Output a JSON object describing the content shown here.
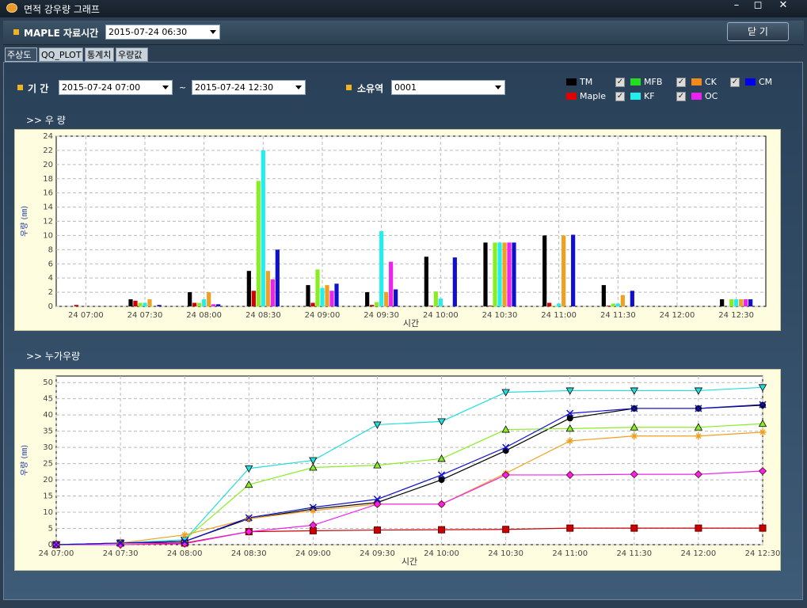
{
  "window": {
    "title": "면적 강우량 그래프",
    "controls": [
      "–",
      "◻",
      "✕"
    ]
  },
  "toolbar": {
    "maple_label": "MAPLE 자료시간",
    "maple_time": "2015-07-24 06:30",
    "close_label": "닫 기"
  },
  "tabs": [
    "주상도",
    "QQ_PLOT",
    "통계치",
    "우량값"
  ],
  "filters": {
    "period_label": "기 간",
    "start": "2015-07-24 07:00",
    "tilde": "~",
    "end": "2015-07-24 12:30",
    "basin_label": "소유역",
    "basin": "0001"
  },
  "legend": [
    {
      "name": "TM",
      "color": "#000000",
      "checkbox": false
    },
    {
      "name": "Maple",
      "color": "#e00000",
      "checkbox": false
    },
    {
      "name": "MFB",
      "color": "#22dd22",
      "checkbox": true
    },
    {
      "name": "KF",
      "color": "#22eeee",
      "checkbox": true
    },
    {
      "name": "CK",
      "color": "#f28a1a",
      "checkbox": true
    },
    {
      "name": "OC",
      "color": "#ee22ee",
      "checkbox": true
    },
    {
      "name": "CM",
      "color": "#0000ee",
      "checkbox": true
    }
  ],
  "sections": {
    "rain": ">> 우  량",
    "cumulative": ">> 누가우량"
  },
  "chart_data": [
    {
      "type": "bar",
      "ylabel": "우량 (㎜)",
      "xlabel": "시간",
      "ylim": [
        0,
        24
      ],
      "yticks": [
        0,
        2,
        4,
        6,
        8,
        10,
        12,
        14,
        16,
        18,
        20,
        22,
        24
      ],
      "categories": [
        "24 07:00",
        "24 07:30",
        "24 08:00",
        "24 08:30",
        "24 09:00",
        "24 09:30",
        "24 10:00",
        "24 10:30",
        "24 11:00",
        "24 11:30",
        "24 12:00",
        "24 12:30"
      ],
      "series": [
        {
          "name": "TM",
          "color": "#000000",
          "values": [
            0,
            1,
            2,
            5,
            3,
            2,
            7,
            9,
            10,
            3,
            0,
            1
          ]
        },
        {
          "name": "Maple",
          "color": "#d00000",
          "values": [
            0.2,
            0.8,
            0.5,
            2.2,
            0.5,
            0.2,
            0.1,
            0.1,
            0.5,
            0.1,
            0,
            0
          ]
        },
        {
          "name": "MFB",
          "color": "#88ee22",
          "values": [
            0,
            0.5,
            0.5,
            17.7,
            5.2,
            0.6,
            2.1,
            9,
            0.1,
            0.4,
            0,
            1
          ]
        },
        {
          "name": "KF",
          "color": "#22eeee",
          "values": [
            0,
            0.5,
            1,
            22,
            2.6,
            10.6,
            1.1,
            9,
            0.4,
            0.4,
            0,
            1
          ]
        },
        {
          "name": "CK",
          "color": "#f0a020",
          "values": [
            0,
            1,
            2,
            5,
            3,
            2,
            0,
            9,
            10,
            1.6,
            0,
            1
          ]
        },
        {
          "name": "OC",
          "color": "#ee22ee",
          "values": [
            0,
            0,
            0.3,
            3.8,
            2.2,
            6.3,
            0,
            9,
            0,
            0,
            0,
            1
          ]
        },
        {
          "name": "CM",
          "color": "#1010cc",
          "values": [
            0,
            0.2,
            0.3,
            8,
            3.2,
            2.4,
            6.9,
            9,
            10.1,
            2.2,
            0,
            1
          ]
        }
      ]
    },
    {
      "type": "line",
      "ylabel": "우량 (㎜)",
      "xlabel": "시간",
      "ylim": [
        0,
        52
      ],
      "yticks": [
        0,
        5,
        10,
        15,
        20,
        25,
        30,
        35,
        40,
        45,
        50
      ],
      "categories": [
        "24 07:00",
        "24 07:30",
        "24 08:00",
        "24 08:30",
        "24 09:00",
        "24 09:30",
        "24 10:00",
        "24 10:30",
        "24 11:00",
        "24 11:30",
        "24 12:00",
        "24 12:30"
      ],
      "series": [
        {
          "name": "TM",
          "color": "#000000",
          "marker": "circle",
          "values": [
            0,
            0.5,
            1,
            8,
            11,
            13,
            20,
            29,
            39,
            42,
            42,
            43
          ]
        },
        {
          "name": "Maple",
          "color": "#cc0000",
          "marker": "square",
          "values": [
            0,
            0.5,
            0.5,
            4,
            4.3,
            4.5,
            4.6,
            4.7,
            5.1,
            5.1,
            5.1,
            5.1
          ]
        },
        {
          "name": "MFB",
          "color": "#88ee22",
          "marker": "triangle",
          "values": [
            0,
            0.5,
            1.5,
            18.5,
            23.8,
            24.5,
            26.5,
            35.5,
            35.8,
            36.2,
            36.2,
            37.3
          ]
        },
        {
          "name": "KF",
          "color": "#22dddd",
          "marker": "triangle-down",
          "values": [
            0,
            0.5,
            1.5,
            23.5,
            26,
            37,
            38,
            47,
            47.5,
            47.5,
            47.5,
            48.5
          ]
        },
        {
          "name": "CK",
          "color": "#f0a020",
          "marker": "star",
          "values": [
            0,
            0.5,
            3,
            8,
            10.5,
            12.5,
            12.5,
            22,
            32,
            33.5,
            33.5,
            34.7
          ]
        },
        {
          "name": "OC",
          "color": "#ee22ee",
          "marker": "diamond",
          "values": [
            0,
            0,
            0.3,
            4,
            6,
            12.5,
            12.5,
            21.5,
            21.5,
            21.7,
            21.7,
            22.7
          ]
        },
        {
          "name": "CM",
          "color": "#1010cc",
          "marker": "x",
          "values": [
            0,
            0.5,
            1,
            8.3,
            11.5,
            14,
            21.5,
            30,
            40.5,
            42,
            42,
            43.2
          ]
        }
      ]
    }
  ]
}
